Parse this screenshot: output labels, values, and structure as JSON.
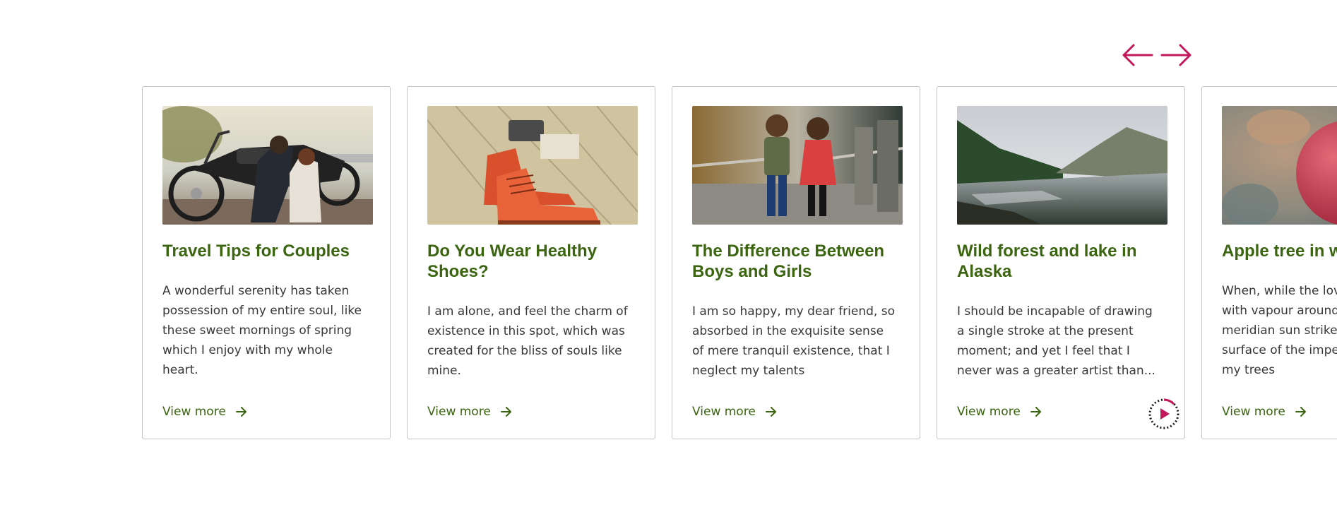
{
  "colors": {
    "accent": "#c2185b",
    "title_green": "#3b6510",
    "body_text": "#383838",
    "card_border": "#c4c4c4"
  },
  "navigation": {
    "prev_icon": "arrow-left-icon",
    "next_icon": "arrow-right-icon"
  },
  "cards": [
    {
      "title": "Travel Tips for Couples",
      "text": "A wonderful serenity has taken possession of my entire soul, like these sweet mornings of spring which I enjoy with my whole heart.",
      "link": "View more",
      "image": "couple-with-motorcycle"
    },
    {
      "title": "Do You Wear Healthy Shoes?",
      "text": "I am alone, and feel the charm of existence in this spot, which was created for the bliss of souls like mine.",
      "link": "View more",
      "image": "red-leather-shoes"
    },
    {
      "title": "The Difference Between Boys and Girls",
      "text": "I am so happy, my dear friend, so absorbed in the exquisite sense of mere tranquil existence, that I neglect my talents",
      "link": "View more",
      "image": "two-children-on-bridge"
    },
    {
      "title": "Wild forest and lake in Alaska",
      "text": "I should be incapable of drawing a single stroke at the present moment; and yet I feel that I never was a greater artist than...",
      "link": "View more",
      "image": "forest-lake-mountains"
    },
    {
      "title": "Apple tree in w",
      "text_lines": [
        "When, while the lov",
        "with vapour around",
        "meridian sun strikes",
        "surface of the imper",
        "my trees"
      ],
      "link": "View more",
      "image": "red-apple-closeup"
    }
  ],
  "autoplay": {
    "icon": "play-icon"
  }
}
